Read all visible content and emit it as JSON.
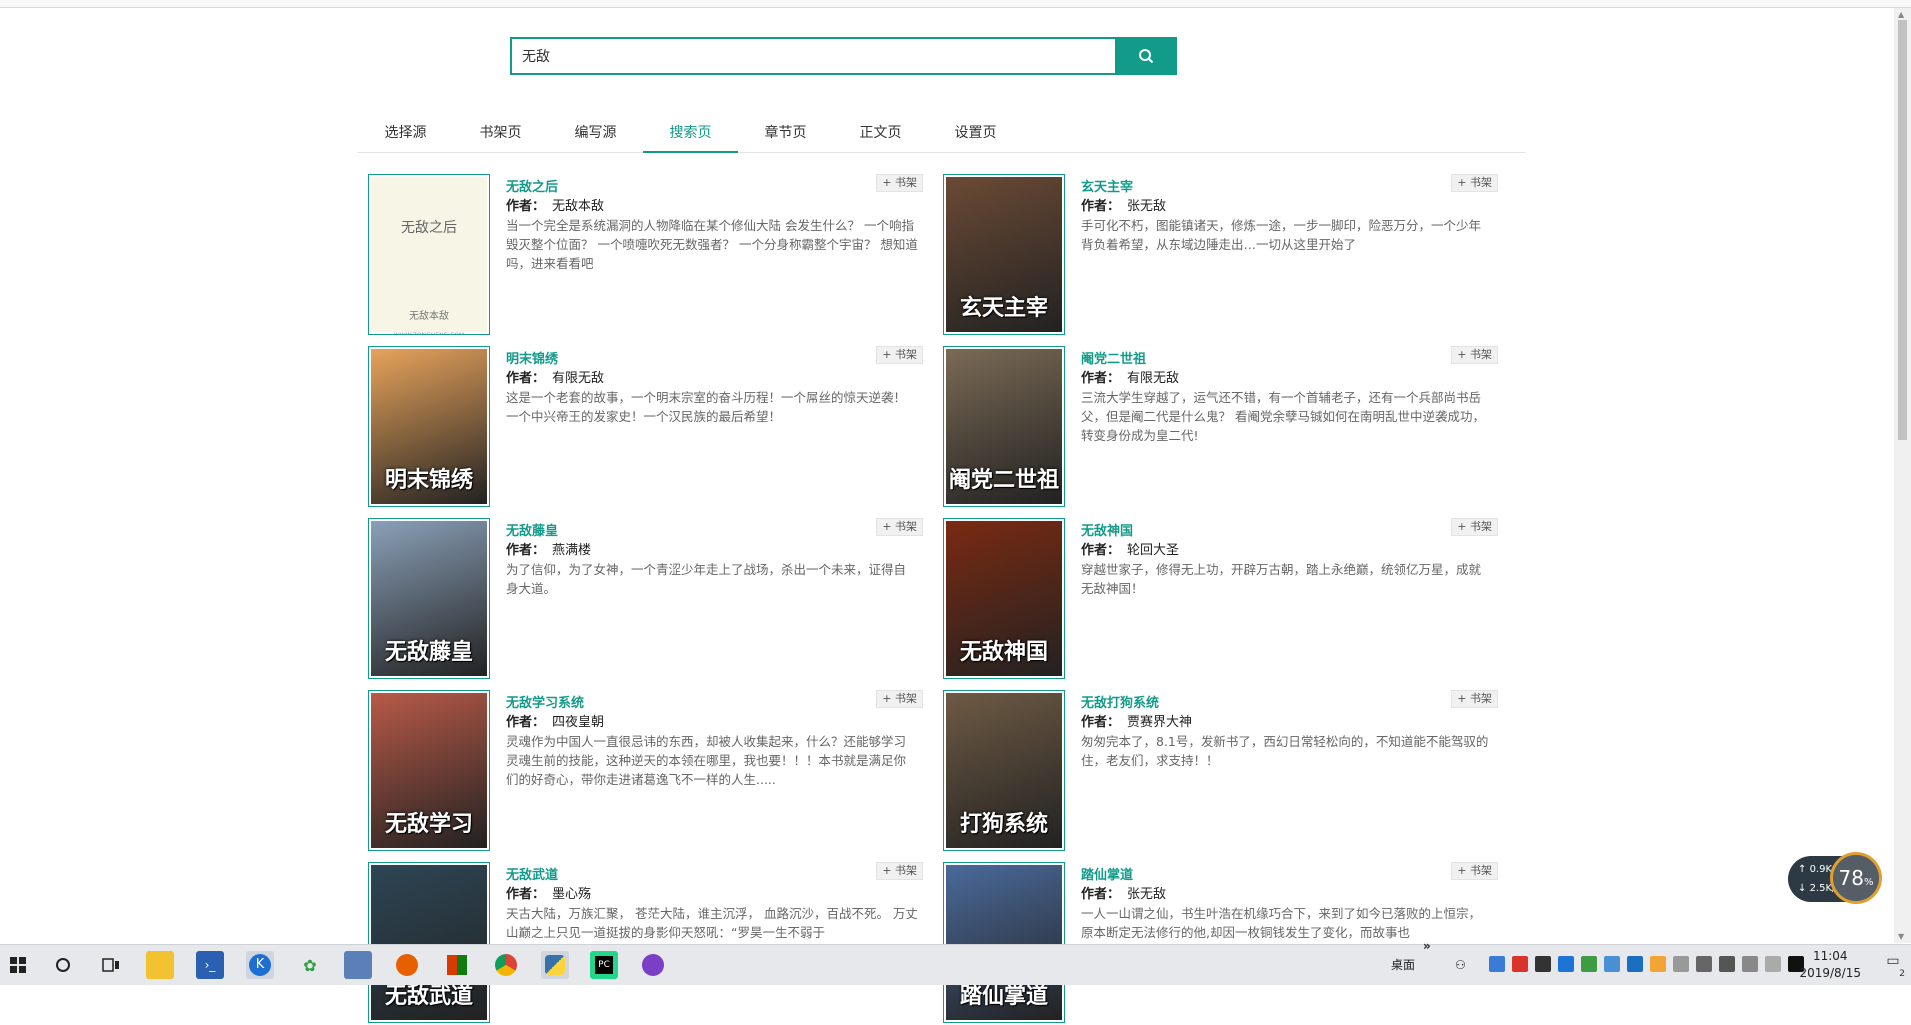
{
  "search": {
    "value": "无敌",
    "button_icon": "search-icon"
  },
  "tabs": [
    {
      "label": "选择源"
    },
    {
      "label": "书架页"
    },
    {
      "label": "编写源"
    },
    {
      "label": "搜索页",
      "active": true
    },
    {
      "label": "章节页"
    },
    {
      "label": "正文页"
    },
    {
      "label": "设置页"
    }
  ],
  "author_label": "作者：",
  "shelf_label": "+ 书架",
  "books": [
    {
      "title": "无敌之后",
      "author": "无敌本敌",
      "desc": "当一个完全是系统漏洞的人物降临在某个修仙大陆 会发生什么？ 一个响指毁灭整个位面？ 一个喷嚏吹死无数强者？ 一个分身称霸整个宇宙？ 想知道吗，进来看看吧",
      "cover_color": "#f6f5e6",
      "cover_plain": true,
      "cover_title": "无敌之后",
      "cover_author": "无敌本敌",
      "cover_url": "WWW.ZONGHENG.COM"
    },
    {
      "title": "玄天主宰",
      "author": "张无敌",
      "desc": "手可化不朽，图能镇诸天，修炼一途，一步一脚印，险恶万分，一个少年背负着希望，从东域边陲走出…一切从这里开始了",
      "cover_color": "#6b4a35",
      "cover_text": "玄天主宰"
    },
    {
      "title": "明末锦绣",
      "author": "有限无敌",
      "desc": "这是一个老套的故事，一个明末宗室的奋斗历程！一个屌丝的惊天逆袭！一个中兴帝王的发家史！一个汉民族的最后希望！",
      "cover_color": "#e7a35c",
      "cover_text": "明末锦绣"
    },
    {
      "title": "阉党二世祖",
      "author": "有限无敌",
      "desc": "三流大学生穿越了，运气还不错，有一个首辅老子，还有一个兵部尚书岳父，但是阉二代是什么鬼？ 看阉党余孽马铖如何在南明乱世中逆袭成功，转变身份成为皇二代!",
      "cover_color": "#7a6a55",
      "cover_text": "阉党二世祖"
    },
    {
      "title": "无敌藤皇",
      "author": "燕满楼",
      "desc": "为了信仰，为了女神，一个青涩少年走上了战场，杀出一个未来，证得自身大道。",
      "cover_color": "#8aa0b8",
      "cover_text": "无敌藤皇"
    },
    {
      "title": "无敌神国",
      "author": "轮回大圣",
      "desc": "穿越世家子，修得无上功，开辟万古朝，踏上永绝巅，统领亿万星，成就无敌神国！",
      "cover_color": "#7a2a12",
      "cover_text": "无敌神国"
    },
    {
      "title": "无敌学习系统",
      "author": "四夜皇朝",
      "desc": "灵魂作为中国人一直很忌讳的东西，却被人收集起来，什么？还能够学习灵魂生前的技能，这种逆天的本领在哪里，我也要！！！本书就是满足你们的好奇心，带你走进诸葛逸飞不一样的人生.....",
      "cover_color": "#b85a48",
      "cover_text": "无敌学习"
    },
    {
      "title": "无敌打狗系统",
      "author": "贾赛界大神",
      "desc": "匆匆完本了，8.1号，发新书了，西幻日常轻松向的，不知道能不能驾驭的住，老友们，求支持！！",
      "cover_color": "#6e5a44",
      "cover_text": "打狗系统"
    },
    {
      "title": "无敌武道",
      "author": "墨心殇",
      "desc": "天古大陆，万族汇聚， 苍茫大陆，谁主沉浮， 血路沉沙，百战不死。 万丈山巅之上只见一道挺拔的身影仰天怒吼：“罗昊一生不弱于",
      "cover_color": "#2d4655",
      "cover_text": "无敌武道"
    },
    {
      "title": "踏仙掌道",
      "author": "张无敌",
      "desc": "一人一山谓之仙，书生叶浩在机缘巧合下，来到了如今已落败的上恒宗，原本断定无法修行的他,却因一枚铜钱发生了变化，而故事也",
      "cover_color": "#4a6a9a",
      "cover_text": "踏仙掌道"
    }
  ],
  "speed": {
    "up": "0.9K/s",
    "down": "2.5K/s",
    "percent": "78",
    "percent_unit": "%"
  },
  "taskbar": {
    "desktop_label": "桌面",
    "expand": "»",
    "time": "11:04",
    "date": "2019/8/15",
    "notification_count": "2"
  }
}
